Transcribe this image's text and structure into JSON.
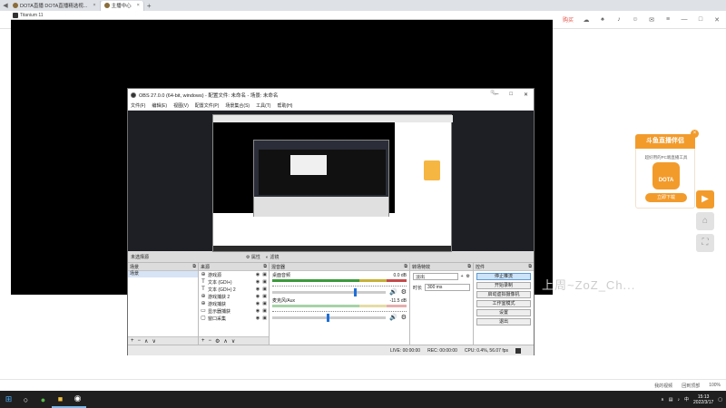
{
  "browser": {
    "tabs": [
      {
        "label": "DOTA直播 DOTA直播精选视...",
        "active": false
      },
      {
        "label": "主播中心",
        "active": true
      }
    ],
    "add_tab": "+",
    "toolbar_red_label": "购买"
  },
  "dark_window": {
    "title": "Titanium 11"
  },
  "obs": {
    "title": "OBS 27.0.0 (64-bit, windows) - 配置文件: 未命名 - 场景: 未命名",
    "window_controls": [
      "—",
      "□",
      "✕"
    ],
    "menu": [
      "文件(F)",
      "编辑(E)",
      "视图(V)",
      "配置文件(P)",
      "场景集合(S)",
      "工具(T)",
      "帮助(H)"
    ],
    "no_source": "未选择源",
    "props_label": "属性",
    "filter_label": "滤镜",
    "docks": {
      "scenes": {
        "title": "场景",
        "items": [
          "场景"
        ]
      },
      "sources": {
        "title": "来源",
        "items": [
          {
            "label": "游戏源",
            "icon": "gamepad-icon"
          },
          {
            "label": "文本 (GDI+)",
            "icon": "text-icon"
          },
          {
            "label": "文本 (GDI+) 2",
            "icon": "text-icon"
          },
          {
            "label": "游戏捕获 2",
            "icon": "gamepad-icon"
          },
          {
            "label": "游戏捕获",
            "icon": "gamepad-icon"
          },
          {
            "label": "显示器捕获",
            "icon": "monitor-icon"
          },
          {
            "label": "窗口采集",
            "icon": "window-icon"
          }
        ]
      },
      "mixer": {
        "title": "混音器",
        "channels": [
          {
            "name": "桌面音频",
            "db": "0.0 dB",
            "level": 0.72
          },
          {
            "name": "麦克风/Aux",
            "db": "-11.5 dB",
            "level": 0.48
          }
        ]
      },
      "transitions": {
        "title": "转场特效",
        "selected": "淡出",
        "duration_label": "时长",
        "duration_value": "300 ms"
      },
      "controls": {
        "title": "控件",
        "buttons": [
          "停止推流",
          "开始录制",
          "启动虚拟摄像机",
          "工作室模式",
          "设置",
          "退出"
        ]
      }
    },
    "statusbar": {
      "live": "LIVE: 00:00:00",
      "rec": "REC: 00:00:00",
      "cpu": "CPU: 0.4%, 56.07 fps"
    }
  },
  "promo": {
    "title": "斗鱼直播伴侣",
    "desc": "超好用的PC端直播工具",
    "logo_text": "DOTA",
    "button": "立即下载"
  },
  "watermark": "上周~ZoZ_Ch...",
  "page_bottom": {
    "items": [
      "我的视频",
      "回到顶部",
      "100%"
    ]
  },
  "taskbar": {
    "time": "15:13",
    "date": "2022/3/17"
  }
}
